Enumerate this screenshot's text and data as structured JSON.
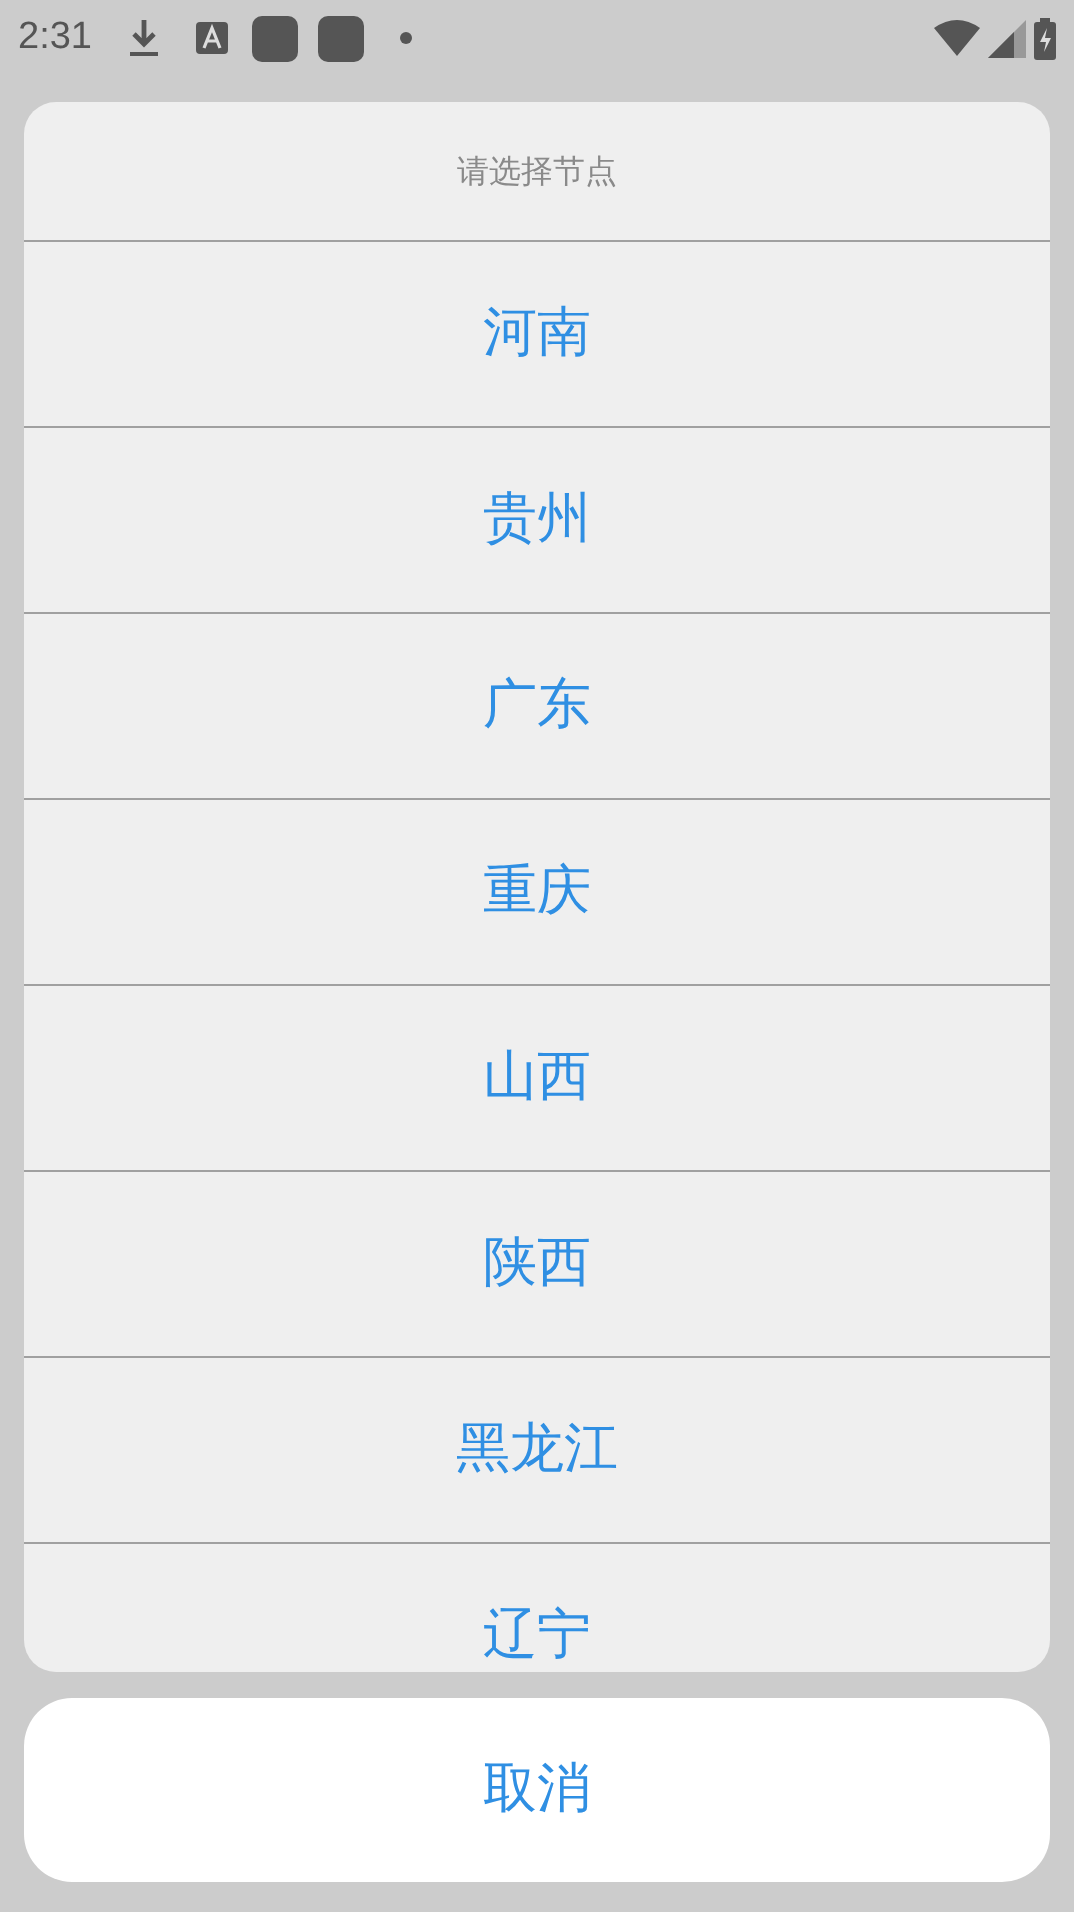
{
  "status_bar": {
    "time": "2:31"
  },
  "sheet": {
    "title": "请选择节点",
    "options": [
      "河南",
      "贵州",
      "广东",
      "重庆",
      "山西",
      "陕西",
      "黑龙江",
      "辽宁"
    ],
    "cancel": "取消"
  }
}
